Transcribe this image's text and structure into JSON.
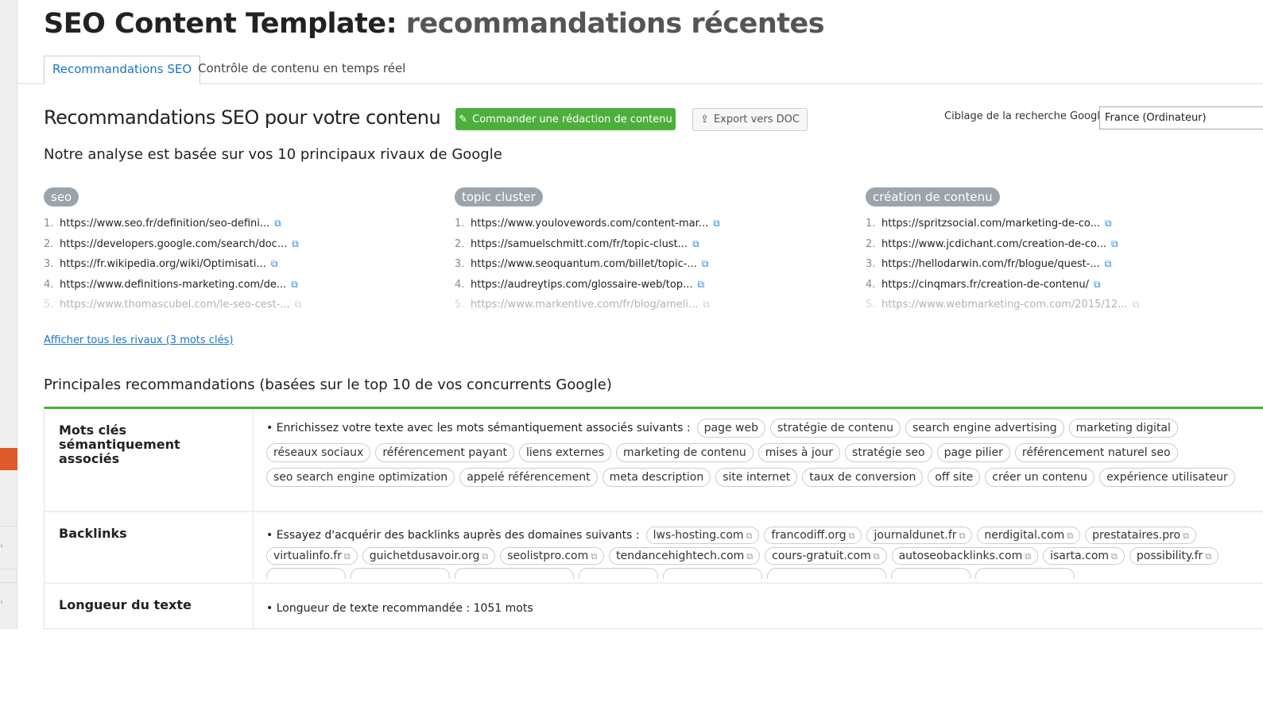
{
  "header": {
    "title_main": "SEO Content Template:",
    "title_sub": "recommandations récentes"
  },
  "tabs": [
    {
      "label": "Recommandations SEO",
      "active": true
    },
    {
      "label": "Contrôle de contenu en temps réel",
      "active": false
    }
  ],
  "section": {
    "title": "Recommandations SEO pour votre contenu",
    "order_button": "Commander une rédaction de contenu",
    "export_button": "Export vers DOC",
    "targeting_label": "Ciblage de la recherche Google:",
    "targeting_value": "France (Ordinateur)"
  },
  "analysis_text": "Notre analyse est basée sur vos 10 principaux rivaux de Google",
  "keywords": [
    {
      "name": "seo",
      "urls": [
        "https://www.seo.fr/definition/seo-defini...",
        "https://developers.google.com/search/doc...",
        "https://fr.wikipedia.org/wiki/Optimisati...",
        "https://www.definitions-marketing.com/de...",
        "https://www.thomascubel.com/le-seo-cest-..."
      ]
    },
    {
      "name": "topic cluster",
      "urls": [
        "https://www.youlovewords.com/content-mar...",
        "https://samuelschmitt.com/fr/topic-clust...",
        "https://www.seoquantum.com/billet/topic-...",
        "https://audreytips.com/glossaire-web/top...",
        "https://www.markentive.com/fr/blog/ameli..."
      ]
    },
    {
      "name": "création de contenu",
      "urls": [
        "https://spritzsocial.com/marketing-de-co...",
        "https://www.jcdichant.com/creation-de-co...",
        "https://hellodarwin.com/fr/blogue/quest-...",
        "https://cinqmars.fr/creation-de-contenu/",
        "https://www.webmarketing-com.com/2015/12..."
      ]
    }
  ],
  "show_all_link": "Afficher tous les rivaux (3 mots clés)",
  "recommendations_title": "Principales recommandations (basées sur le top 10 de vos concurrents Google)",
  "semantic": {
    "label": "Mots clés sémantiquement associés",
    "lead": "• Enrichissez votre texte avec les mots sémantiquement associés suivants :",
    "terms": [
      "page web",
      "stratégie de contenu",
      "search engine advertising",
      "marketing digital",
      "réseaux sociaux",
      "référencement payant",
      "liens externes",
      "marketing de contenu",
      "mises à jour",
      "stratégie seo",
      "page pilier",
      "référencement naturel seo",
      "seo search engine optimization",
      "appelé référencement",
      "meta description",
      "site internet",
      "taux de conversion",
      "off site",
      "créer un contenu",
      "expérience utilisateur"
    ]
  },
  "backlinks": {
    "label": "Backlinks",
    "lead": "• Essayez d'acquérir des backlinks auprès des domaines suivants :",
    "domains": [
      "lws-hosting.com",
      "francodiff.org",
      "journaldunet.fr",
      "nerdigital.com",
      "prestataires.pro",
      "virtualinfo.fr",
      "guichetdusavoir.org",
      "seolistpro.com",
      "tendancehightech.com",
      "cours-gratuit.com",
      "autoseobacklinks.com",
      "isarta.com",
      "possibility.fr"
    ]
  },
  "length": {
    "label": "Longueur du texte",
    "text": "• Longueur de texte recommandée :  1051 mots"
  },
  "colors": {
    "accent_green": "#4caf3c",
    "link_blue": "#1a73c5",
    "sidebar_marker": "#e05a2b",
    "badge_gray": "#9aa5ab"
  },
  "icons": {
    "order": "edit-icon",
    "export": "upload-icon",
    "external": "external-link-icon"
  }
}
